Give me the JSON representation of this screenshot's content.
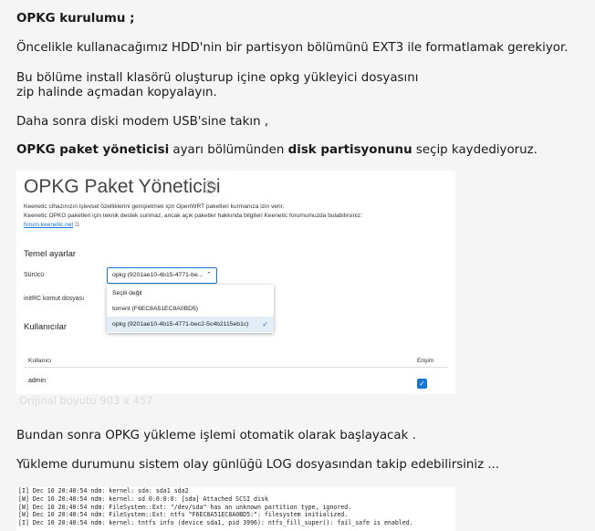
{
  "post": {
    "heading": "OPKG kurulumu ;",
    "p1": "Öncelikle kullanacağımız HDD'nin bir partisyon bölümünü EXT3 ile formatlamak gerekiyor.",
    "p2_line1": "Bu bölüme install klasörü oluşturup içine opkg yükleyici dosyasını",
    "p2_line2": "zip halinde açmadan kopyalayın.",
    "p3": "Daha sonra diski modem USB'sine takın ,",
    "p4": {
      "b1": "OPKG paket yöneticisi",
      "t1": " ayarı bölümünden ",
      "b2": "disk partisyonunu",
      "t2": " seçip kaydediyoruz."
    },
    "image_caption": "Orijinal boyutu 903 x 457",
    "p5": "Bundan sonra OPKG yükleme işlemi otomatik olarak başlayacak .",
    "p6": "Yükleme durumunu sistem olay günlüğü LOG dosyasından takip edebilirsiniz ..."
  },
  "screenshot": {
    "title": "OPKG Paket Yöneticisi",
    "help_icon": "question-circle-icon",
    "desc_line1": "Keenetic cihazınızın işlevsel özelliklerini genişletmek için OpenWRT paketleri kurmanıza izin verir.",
    "desc_line2": "Keenetic OPKG paketleri için teknik destek sunmaz, ancak açık paketler hakkında bilgileri Keenetic forumumuzda bulabilirsiniz:",
    "desc_link": "forum.keenetic.net",
    "section_basic": "Temel ayarlar",
    "label_drive": "Sürücü",
    "drive_value": "opkg (9201ae10-4b15-4771-be...",
    "label_initrc": "initRC komut dosyası",
    "dropdown_options": [
      "Seçili değil",
      "torrent (F6EC8A51EC8A0BD5)",
      "opkg (9201ae10-4b15-4771-bec2-5c4b2115eb1c)"
    ],
    "section_users": "Kullanıcılar",
    "col_user": "Kullanıcı",
    "col_access": "Erişim",
    "user_row": "admin",
    "accent_color": "#1976d2"
  },
  "log_lines": [
    "[I] Dec 10 20:40:54 ndm: kernel:  sda: sda1 sda2",
    "[W] Dec 10 20:40:54 ndm: kernel: sd 0:0:0:0: [sda] Attached SCSI disk",
    "[W] Dec 10 20:40:54 ndm: FileSystem::Ext: \"/dev/sda\" has an unknown partition type, ignored.",
    "[W] Dec 10 20:40:54 ndm: FileSystem::Ext: ntfs \"F6EC8A51EC8A0BD5:\": filesystem initialized.",
    "[I] Dec 10 20:40:54 ndm: kernel: tntfs info (device sda1, pid 3996): ntfs_fill_super(): fail_safe is enabled."
  ]
}
